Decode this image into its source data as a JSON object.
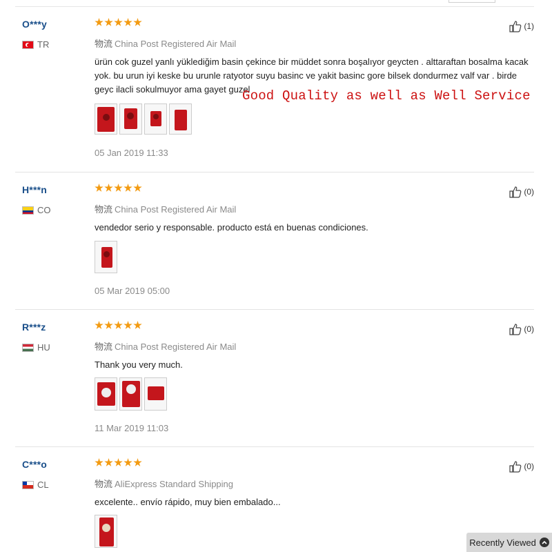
{
  "ship_prefix": "物流",
  "reviews": [
    {
      "user": "O***y",
      "country": "TR",
      "shipping": "China Post Registered Air Mail",
      "text": "ürün cok guzel yanlı yüklediğim basin çekince bir müddet sonra boşalıyor geycten . alttaraftan bosalma kacak yok. bu urun iyi keske bu urunle ratyotor suyu basinc ve yakit basinc gore bilsek dondurmez valf var . birde geyc ilacli sokulmuyor ama gayet guzel",
      "date": "05 Jan 2019 11:33",
      "helpful": "(1)",
      "photos": 4
    },
    {
      "user": "H***n",
      "country": "CO",
      "shipping": "China Post Registered Air Mail",
      "text": "vendedor serio y responsable. producto está en buenas condiciones.",
      "date": "05 Mar 2019 05:00",
      "helpful": "(0)",
      "photos": 1
    },
    {
      "user": "R***z",
      "country": "HU",
      "shipping": "China Post Registered Air Mail",
      "text": "Thank you very much.",
      "date": "11 Mar 2019 11:03",
      "helpful": "(0)",
      "photos": 3
    },
    {
      "user": "C***o",
      "country": "CL",
      "shipping": "AliExpress Standard Shipping",
      "text": "excelente.. envío rápido, muy bien embalado...",
      "date": "",
      "helpful": "(0)",
      "photos": 1
    }
  ],
  "annotation": "Good Quality as well as Well Service",
  "recently_viewed": "Recently Viewed",
  "icons": {
    "helpful": "thumbs-up-icon",
    "recent": "chevron-up-icon"
  },
  "colors": {
    "star": "#f39b12",
    "username": "#1a4f8a",
    "annotation": "#cc1111"
  }
}
